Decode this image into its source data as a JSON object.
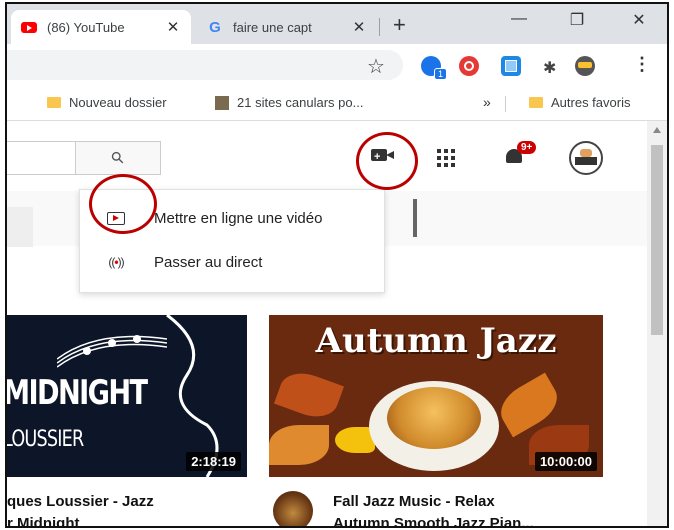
{
  "browser": {
    "tabs": [
      {
        "title": "(86) YouTube",
        "icon": "youtube-favicon",
        "active": true
      },
      {
        "title": "faire une capt",
        "icon": "google-favicon",
        "active": false
      }
    ],
    "close_glyph": "✕",
    "new_tab_glyph": "+",
    "window_controls": {
      "minimize": "—",
      "maximize": "❐",
      "close": "✕"
    },
    "star_glyph": "☆",
    "extension_badge": "1",
    "menu_glyph": "⋮",
    "bookmarks": [
      {
        "label": "Nouveau dossier",
        "icon": "folder-icon"
      },
      {
        "label": "21 sites canulars po...",
        "icon": "site-icon"
      }
    ],
    "bookmarks_more": "»",
    "other_bookmarks": "Autres favoris"
  },
  "youtube": {
    "search_glyph": "⚲",
    "notification_badge": "9+",
    "create_menu": {
      "items": [
        {
          "label": "Mettre en ligne une vidéo",
          "icon": "upload-video-icon"
        },
        {
          "label": "Passer au direct",
          "icon": "go-live-icon"
        }
      ]
    },
    "videos": [
      {
        "thumb_text_1": "MIDNIGHT",
        "thumb_text_2": "LOUSSIER",
        "duration": "2:18:19",
        "title_line_1": "ques Loussier - Jazz",
        "title_line_2": "r Midnight"
      },
      {
        "thumb_title": "Autumn Jazz",
        "duration": "10:00:00",
        "title_line_1": "Fall Jazz Music - Relax",
        "title_line_2": "Autumn Smooth Jazz Pian..."
      }
    ]
  },
  "colors": {
    "annotation": "#b00000",
    "youtube_red": "#ff0000",
    "tabstrip": "#dee1e6"
  }
}
